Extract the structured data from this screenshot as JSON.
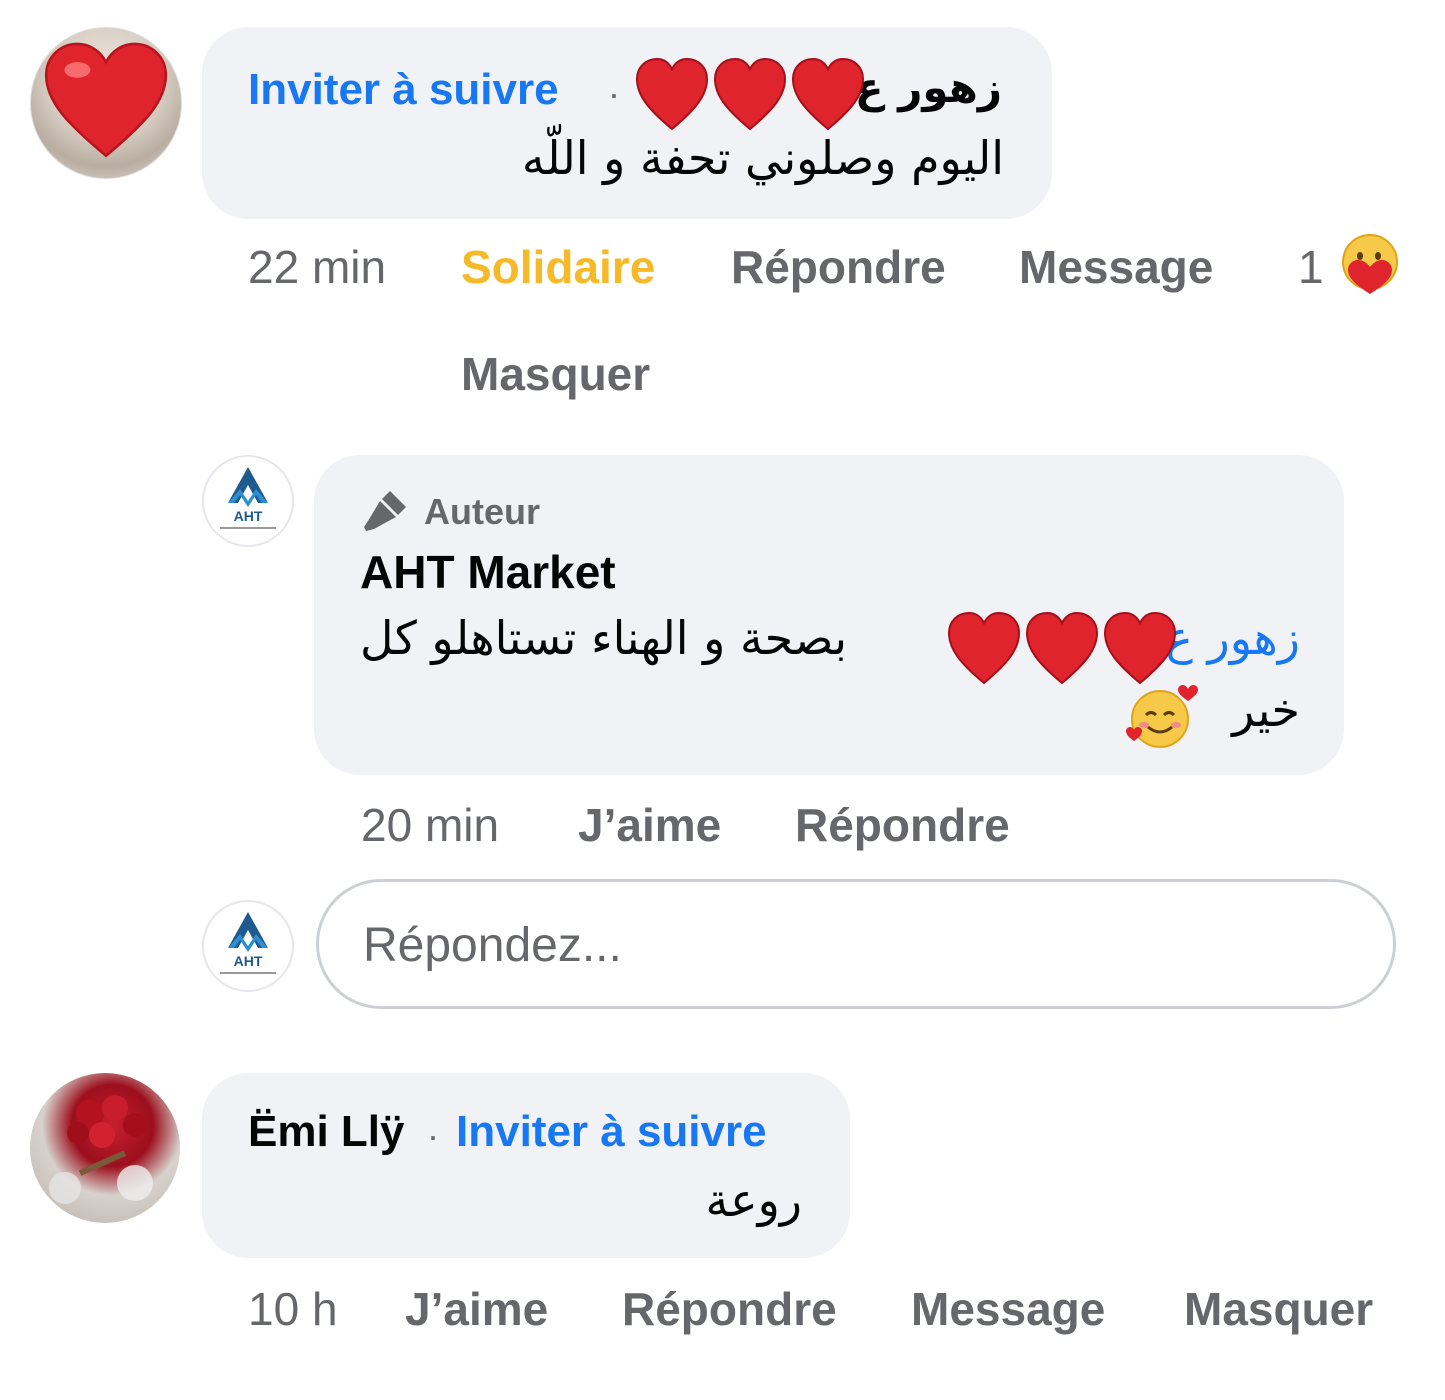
{
  "comment1": {
    "invite_label": "Inviter à suivre",
    "separator": "·",
    "author_name": "زهور ع",
    "text": "اليوم وصلوني تحفة و اللّه",
    "time": "22 min",
    "reaction_label": "Solidaire",
    "reply_label": "Répondre",
    "message_label": "Message",
    "reaction_count": "1",
    "hide_label": "Masquer"
  },
  "reply": {
    "author_tag": "Auteur",
    "author_name": "AHT Market",
    "mention": "زهور ع",
    "text_line1": "بصحة و الهناء تستاهلو كل",
    "text_line2": "خير",
    "time": "20 min",
    "like_label": "J’aime",
    "reply_label": "Répondre",
    "avatar_text": "AHT"
  },
  "reply_input": {
    "placeholder": "Répondez...",
    "avatar_text": "AHT"
  },
  "comment2": {
    "author_name": "Ëmi Llÿ",
    "separator": "·",
    "invite_label": "Inviter à suivre",
    "text": "روعة",
    "time": "10 h",
    "like_label": "J’aime",
    "reply_label": "Répondre",
    "message_label": "Message",
    "hide_label": "Masquer"
  },
  "colors": {
    "link": "#1877f2",
    "meta": "#65676b",
    "reaction_active": "#f7b928",
    "bubble": "#f0f2f5",
    "heart": "#e0242e"
  }
}
